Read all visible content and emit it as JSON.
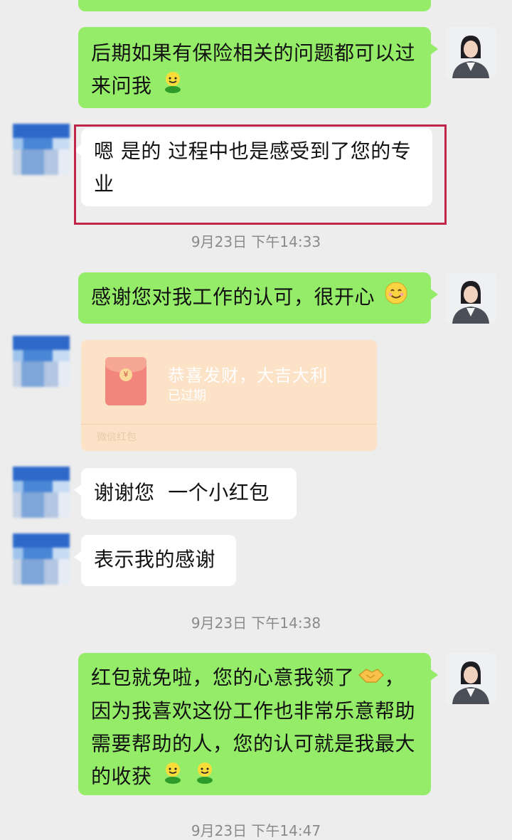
{
  "messages": {
    "m1": "后期如果有保险相关的问题都可以过来问我",
    "m2": "嗯 是的 过程中也是感受到了您的专业",
    "m3": "感谢您对我工作的认可，很开心",
    "m4": "谢谢您  一个小红包",
    "m5": "表示我的感谢",
    "m6": "红包就免啦，您的心意我领了",
    "m6_tail": "，因为我喜欢这份工作也非常乐意帮助需要帮助的人，您的认可就是我最大的收获"
  },
  "timestamps": {
    "t1": "9月23日 下午14:33",
    "t2": "9月23日 下午14:38",
    "t3": "9月23日 下午14:47"
  },
  "red_packet": {
    "title": "恭喜发财，大吉大利",
    "status": "已过期",
    "footer": "微信红包",
    "coin_symbol": "¥"
  },
  "colors": {
    "green_bubble": "#95ec69",
    "white_bubble": "#ffffff",
    "highlight_border": "#c0264a",
    "red_packet_bg": "#fde2c6"
  },
  "icons": [
    "green-smile-emoji-icon",
    "smile-emoji-icon",
    "handshake-emoji-icon"
  ]
}
